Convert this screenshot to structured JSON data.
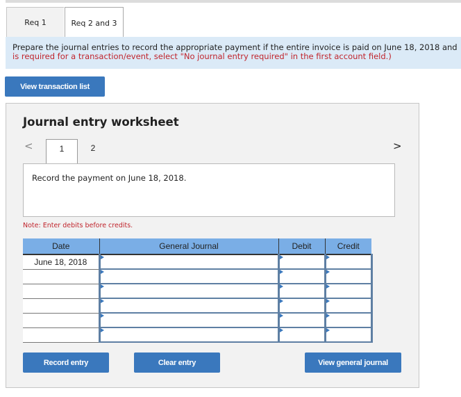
{
  "tabs": [
    {
      "label": "Req 1",
      "active": false
    },
    {
      "label": "Req 2 and 3",
      "active": true
    }
  ],
  "instructions": {
    "line1": "Prepare the journal entries to record the appropriate payment if the entire invoice is paid on June 18, 2018 and",
    "line2": "is required for a transaction/event, select \"No journal entry required\" in the first account field.)"
  },
  "buttons": {
    "view_transaction_list": "View transaction list",
    "record_entry": "Record entry",
    "clear_entry": "Clear entry",
    "view_general_journal": "View general journal"
  },
  "worksheet": {
    "title": "Journal entry worksheet",
    "nav_prev": "<",
    "nav_next": ">",
    "pages": [
      "1",
      "2"
    ],
    "current_page": "1",
    "prompt": "Record the payment on June 18, 2018.",
    "note": "Note: Enter debits before credits."
  },
  "journal_table": {
    "headers": {
      "date": "Date",
      "account": "General Journal",
      "debit": "Debit",
      "credit": "Credit"
    },
    "rows": [
      {
        "date": "June 18, 2018",
        "account": "",
        "debit": "",
        "credit": ""
      },
      {
        "date": "",
        "account": "",
        "debit": "",
        "credit": ""
      },
      {
        "date": "",
        "account": "",
        "debit": "",
        "credit": ""
      },
      {
        "date": "",
        "account": "",
        "debit": "",
        "credit": ""
      },
      {
        "date": "",
        "account": "",
        "debit": "",
        "credit": ""
      },
      {
        "date": "",
        "account": "",
        "debit": "",
        "credit": ""
      }
    ]
  },
  "colors": {
    "button_blue": "#3a78bd",
    "header_blue": "#7aaee6",
    "instruction_bg": "#dbeaf7",
    "note_red": "#c0242c"
  }
}
